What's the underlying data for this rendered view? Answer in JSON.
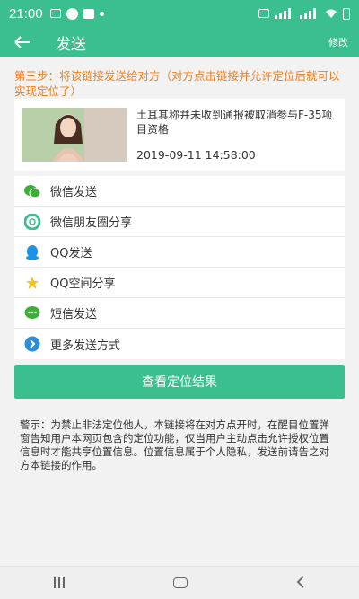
{
  "status_bar": {
    "time": "21:00"
  },
  "app_bar": {
    "title": "发送",
    "modify_label": "修改"
  },
  "step_text": "第三步：将该链接发送给对方（对方点击链接并允许定位后就可以实现定位了）",
  "card": {
    "title": "土耳其称并未收到通报被取消参与F-35项目资格",
    "date": "2019-09-11 14:58:00"
  },
  "share_options": [
    {
      "label": "微信发送",
      "icon": "wechat-icon"
    },
    {
      "label": "微信朋友圈分享",
      "icon": "moments-icon"
    },
    {
      "label": "QQ发送",
      "icon": "qq-icon"
    },
    {
      "label": "QQ空间分享",
      "icon": "qzone-star-icon"
    },
    {
      "label": "短信发送",
      "icon": "sms-bubble-icon"
    },
    {
      "label": "更多发送方式",
      "icon": "more-arrow-icon"
    }
  ],
  "result_button_label": "查看定位结果",
  "warning_text": "警示：为禁止非法定位他人，本链接将在对方点开时，在醒目位置弹窗告知用户本网页包含的定位功能，仅当用户主动点击允许授权位置信息时才能共享位置信息。位置信息属于个人隐私，发送前请告之对方本链接的作用。",
  "colors": {
    "primary": "#3cbf8f",
    "step_orange": "#ef7f21"
  }
}
